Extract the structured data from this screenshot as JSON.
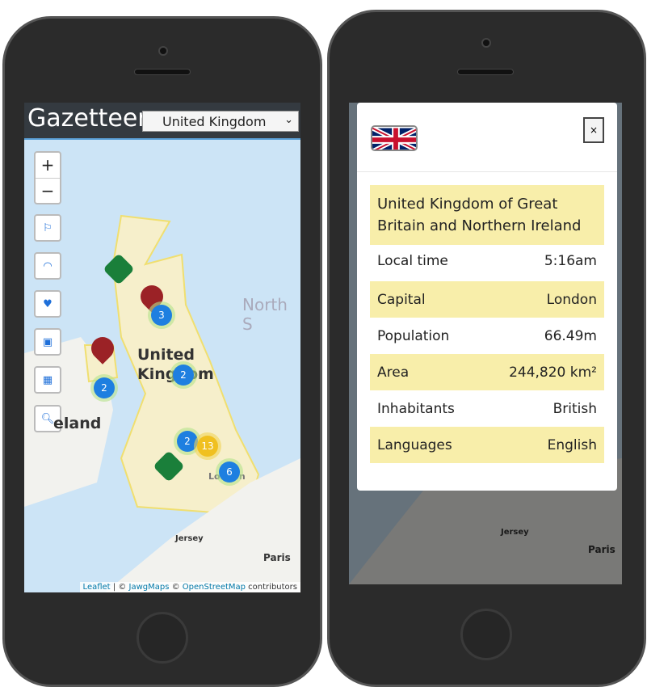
{
  "left_phone": {
    "app_title": "Gazetteer",
    "country_select": {
      "value": "United Kingdom"
    },
    "map": {
      "zoom_in": "+",
      "zoom_out": "−",
      "controls": [
        {
          "icon": "flag-icon"
        },
        {
          "icon": "rainbow-icon"
        },
        {
          "icon": "heart-pulse-icon"
        },
        {
          "icon": "money-icon"
        },
        {
          "icon": "calendar-icon"
        },
        {
          "icon": "zoom-out-icon"
        }
      ],
      "labels": {
        "sea": "North S",
        "country": "United Kingdom",
        "ireland": "eland",
        "jersey": "Jersey",
        "paris": "Paris",
        "london": "London"
      },
      "clusters": [
        "3",
        "2",
        "2",
        "2",
        "13",
        "6"
      ],
      "attribution": {
        "leaflet": "Leaflet",
        "sep": " | © ",
        "jawg": "JawgMaps",
        "osm_pre": " © ",
        "osm": "OpenStreetMap",
        "suffix": " contributors"
      }
    }
  },
  "right_phone": {
    "modal": {
      "flag": "united-kingdom-flag",
      "close": "×",
      "official_name": "United Kingdom of Great Britain and Northern Ireland",
      "rows": [
        {
          "label": "Local time",
          "value": "5:16am"
        },
        {
          "label": "Capital",
          "value": "London"
        },
        {
          "label": "Population",
          "value": "66.49m"
        },
        {
          "label": "Area",
          "value": "244,820 km²"
        },
        {
          "label": "Inhabitants",
          "value": "British"
        },
        {
          "label": "Languages",
          "value": "English"
        }
      ]
    },
    "map": {
      "jersey": "Jersey",
      "paris": "Paris"
    }
  },
  "colors": {
    "topbar": "#343a40",
    "highlight": "#f8eeaa",
    "cluster": "#1e7fe0",
    "pin_red": "#9b2226",
    "pin_green": "#1a7f3a"
  }
}
